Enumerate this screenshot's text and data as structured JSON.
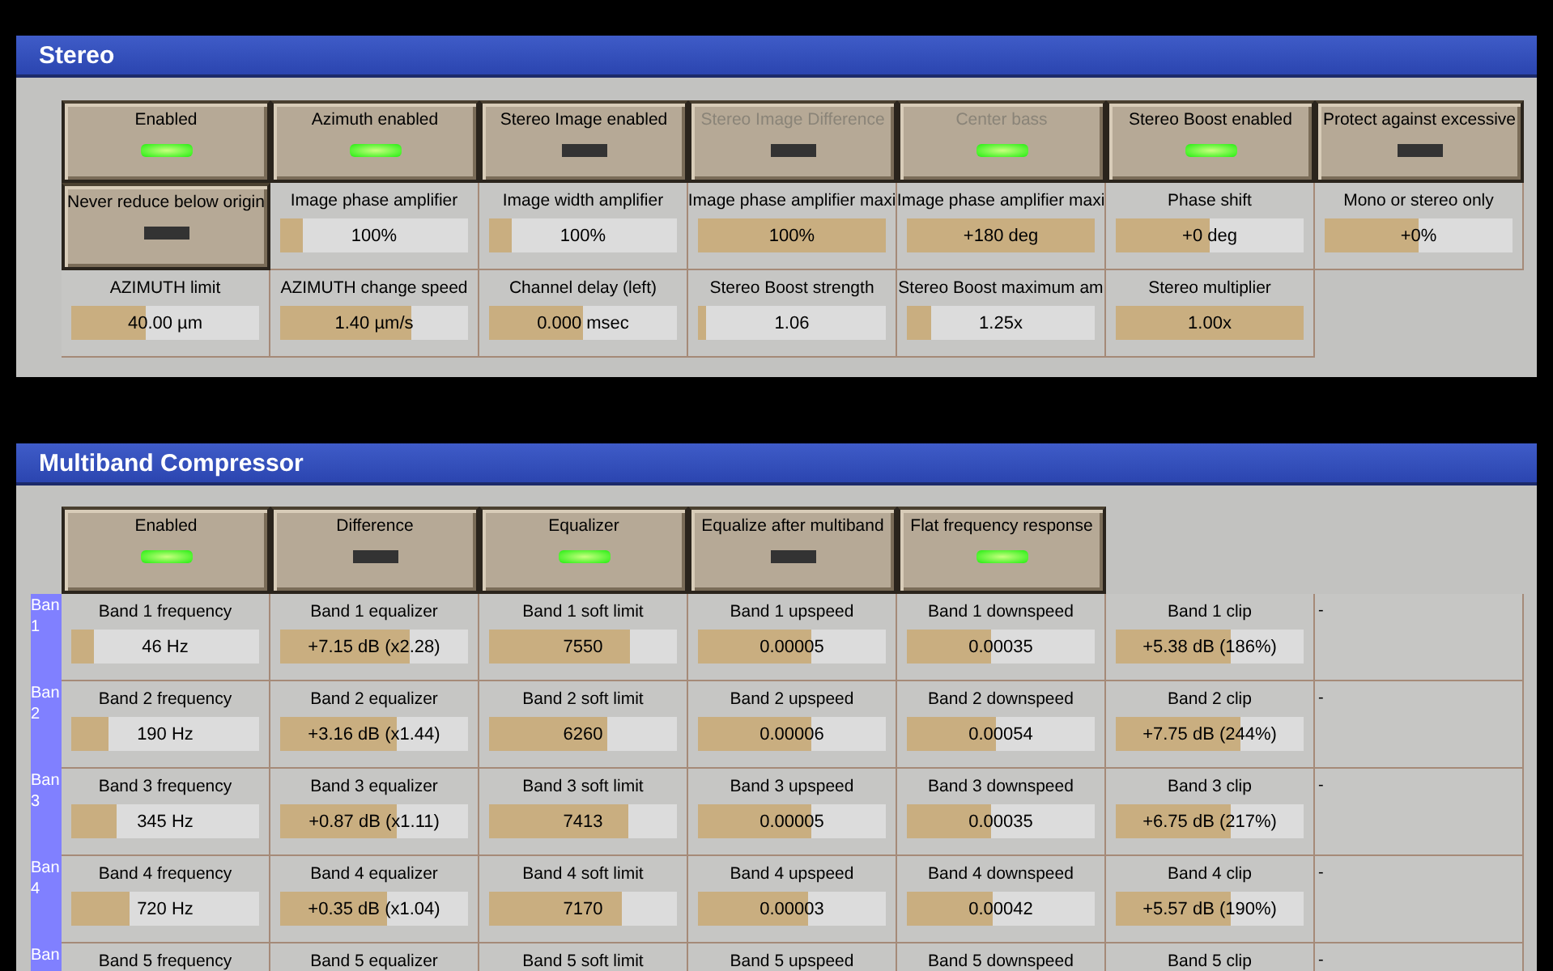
{
  "stereo": {
    "title": "Stereo",
    "rows": [
      [
        {
          "kind": "toggle",
          "label": "Enabled",
          "on": true,
          "disabled": false
        },
        {
          "kind": "toggle",
          "label": "Azimuth enabled",
          "on": true,
          "disabled": false
        },
        {
          "kind": "toggle",
          "label": "Stereo Image enabled",
          "on": false,
          "disabled": false
        },
        {
          "kind": "toggle",
          "label": "Stereo Image Difference",
          "on": false,
          "disabled": true
        },
        {
          "kind": "toggle",
          "label": "Center bass",
          "on": true,
          "disabled": true
        },
        {
          "kind": "toggle",
          "label": "Stereo Boost enabled",
          "on": true,
          "disabled": false
        },
        {
          "kind": "toggle",
          "label": "Protect against excessive",
          "on": false,
          "disabled": false
        }
      ],
      [
        {
          "kind": "toggle",
          "label": "Never reduce below origin",
          "on": false,
          "disabled": false
        },
        {
          "kind": "slider",
          "label": "Image phase amplifier",
          "value": "100%",
          "level": 0.12
        },
        {
          "kind": "slider",
          "label": "Image width amplifier",
          "value": "100%",
          "level": 0.12
        },
        {
          "kind": "slider",
          "label": "Image phase amplifier maxi",
          "value": "100%",
          "level": 1
        },
        {
          "kind": "slider",
          "label": "Image phase amplifier maxi",
          "value": "+180 deg",
          "level": 1
        },
        {
          "kind": "slider",
          "label": "Phase shift",
          "value": "+0 deg",
          "level": 0.5
        },
        {
          "kind": "slider",
          "label": "Mono or stereo only",
          "value": "+0%",
          "level": 0.5
        }
      ],
      [
        {
          "kind": "slider",
          "label": "AZIMUTH limit",
          "value": "40.00 µm",
          "level": 0.4
        },
        {
          "kind": "slider",
          "label": "AZIMUTH change speed",
          "value": "1.40 µm/s",
          "level": 0.7
        },
        {
          "kind": "slider",
          "label": "Channel delay (left)",
          "value": "0.000 msec",
          "level": 0.5
        },
        {
          "kind": "slider",
          "label": "Stereo Boost strength",
          "value": "1.06",
          "level": 0.04
        },
        {
          "kind": "slider",
          "label": "Stereo Boost maximum am",
          "value": "1.25x",
          "level": 0.13
        },
        {
          "kind": "slider",
          "label": "Stereo multiplier",
          "value": "1.00x",
          "level": 1
        }
      ]
    ]
  },
  "multiband": {
    "title": "Multiband Compressor",
    "toggles": [
      {
        "label": "Enabled",
        "on": true
      },
      {
        "label": "Difference",
        "on": false
      },
      {
        "label": "Equalizer",
        "on": true
      },
      {
        "label": "Equalize after multiband",
        "on": false
      },
      {
        "label": "Flat frequency response",
        "on": true
      }
    ],
    "bands": [
      {
        "tag": "Ban 1",
        "note": "-",
        "cells": [
          {
            "label": "Band 1 frequency",
            "value": "46 Hz",
            "level": 0.12
          },
          {
            "label": "Band 1 equalizer",
            "value": "+7.15 dB (x2.28)",
            "level": 0.69
          },
          {
            "label": "Band 1 soft limit",
            "value": "7550",
            "level": 0.75
          },
          {
            "label": "Band 1 upspeed",
            "value": "0.00005",
            "level": 0.6
          },
          {
            "label": "Band 1 downspeed",
            "value": "0.00035",
            "level": 0.45
          },
          {
            "label": "Band 1 clip",
            "value": "+5.38 dB (186%)",
            "level": 0.61
          }
        ]
      },
      {
        "tag": "Ban 2",
        "note": "-",
        "cells": [
          {
            "label": "Band 2 frequency",
            "value": "190 Hz",
            "level": 0.2
          },
          {
            "label": "Band 2 equalizer",
            "value": "+3.16 dB (x1.44)",
            "level": 0.62
          },
          {
            "label": "Band 2 soft limit",
            "value": "6260",
            "level": 0.63
          },
          {
            "label": "Band 2 upspeed",
            "value": "0.00006",
            "level": 0.6
          },
          {
            "label": "Band 2 downspeed",
            "value": "0.00054",
            "level": 0.47
          },
          {
            "label": "Band 2 clip",
            "value": "+7.75 dB (244%)",
            "level": 0.66
          }
        ]
      },
      {
        "tag": "Ban 3",
        "note": "-",
        "cells": [
          {
            "label": "Band 3 frequency",
            "value": "345 Hz",
            "level": 0.24
          },
          {
            "label": "Band 3 equalizer",
            "value": "+0.87 dB (x1.11)",
            "level": 0.62
          },
          {
            "label": "Band 3 soft limit",
            "value": "7413",
            "level": 0.74
          },
          {
            "label": "Band 3 upspeed",
            "value": "0.00005",
            "level": 0.6
          },
          {
            "label": "Band 3 downspeed",
            "value": "0.00035",
            "level": 0.45
          },
          {
            "label": "Band 3 clip",
            "value": "+6.75 dB (217%)",
            "level": 0.61
          }
        ]
      },
      {
        "tag": "Ban 4",
        "note": "-",
        "cells": [
          {
            "label": "Band 4 frequency",
            "value": "720 Hz",
            "level": 0.31
          },
          {
            "label": "Band 4 equalizer",
            "value": "+0.35 dB (x1.04)",
            "level": 0.57
          },
          {
            "label": "Band 4 soft limit",
            "value": "7170",
            "level": 0.71
          },
          {
            "label": "Band 4 upspeed",
            "value": "0.00003",
            "level": 0.59
          },
          {
            "label": "Band 4 downspeed",
            "value": "0.00042",
            "level": 0.46
          },
          {
            "label": "Band 4 clip",
            "value": "+5.57 dB (190%)",
            "level": 0.61
          }
        ]
      },
      {
        "tag": "Ban",
        "note": "-",
        "cells": [
          {
            "label": "Band 5 frequency"
          },
          {
            "label": "Band 5 equalizer"
          },
          {
            "label": "Band 5 soft limit"
          },
          {
            "label": "Band 5 upspeed"
          },
          {
            "label": "Band 5 downspeed"
          },
          {
            "label": "Band 5 clip"
          }
        ]
      }
    ]
  }
}
